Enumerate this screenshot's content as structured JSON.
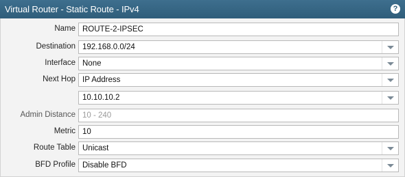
{
  "dialog": {
    "title": "Virtual Router - Static Route - IPv4",
    "help_icon": "?"
  },
  "form": {
    "name": {
      "label": "Name",
      "value": "ROUTE-2-IPSEC"
    },
    "destination": {
      "label": "Destination",
      "value": "192.168.0.0/24"
    },
    "interface": {
      "label": "Interface",
      "value": "None"
    },
    "next_hop": {
      "label": "Next Hop",
      "value": "IP Address"
    },
    "next_hop_address": {
      "value": "10.10.10.2"
    },
    "admin_distance": {
      "label": "Admin Distance",
      "placeholder": "10 - 240"
    },
    "metric": {
      "label": "Metric",
      "value": "10"
    },
    "route_table": {
      "label": "Route Table",
      "value": "Unicast"
    },
    "bfd_profile": {
      "label": "BFD Profile",
      "value": "Disable BFD"
    }
  },
  "colors": {
    "titlebar": "#2f5d7a",
    "background": "#f3f3f3",
    "field_border": "#b8b8b8"
  }
}
